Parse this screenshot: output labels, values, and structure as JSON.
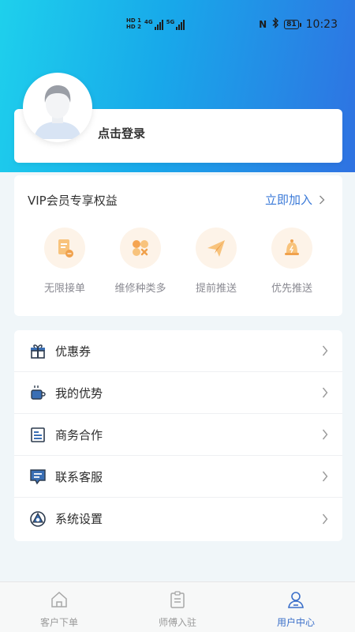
{
  "status_bar": {
    "network_tags": [
      "HD 1",
      "HD 2",
      "4G",
      "5G"
    ],
    "battery": "81",
    "time": "10:23"
  },
  "profile": {
    "login_text": "点击登录"
  },
  "vip": {
    "title": "VIP会员专享权益",
    "join_label": "立即加入",
    "items": [
      {
        "label": "无限接单",
        "icon": "order-document-icon"
      },
      {
        "label": "维修种类多",
        "icon": "repair-tools-icon"
      },
      {
        "label": "提前推送",
        "icon": "paper-plane-icon"
      },
      {
        "label": "优先推送",
        "icon": "priority-bell-icon"
      }
    ],
    "accent_color": "#f5a451"
  },
  "menu": {
    "items": [
      {
        "label": "优惠券",
        "icon": "gift-icon"
      },
      {
        "label": "我的优势",
        "icon": "cup-icon"
      },
      {
        "label": "商务合作",
        "icon": "document-icon"
      },
      {
        "label": "联系客服",
        "icon": "chat-icon"
      },
      {
        "label": "系统设置",
        "icon": "settings-icon"
      }
    ]
  },
  "tabbar": {
    "tabs": [
      {
        "label": "客户下单",
        "icon": "home-icon",
        "active": false
      },
      {
        "label": "师傅入驻",
        "icon": "clipboard-icon",
        "active": false
      },
      {
        "label": "用户中心",
        "icon": "user-icon",
        "active": true
      }
    ],
    "active_color": "#3b6fc9"
  },
  "colors": {
    "header_gradient_start": "#1ed0ec",
    "header_gradient_end": "#2f72e2",
    "link_blue": "#3b7ad8"
  }
}
